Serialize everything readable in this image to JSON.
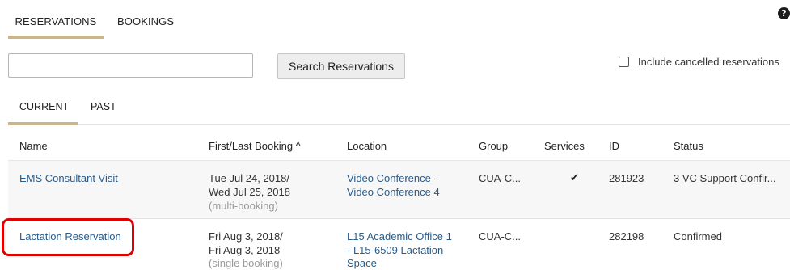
{
  "top_tabs": [
    {
      "label": "RESERVATIONS",
      "active": true
    },
    {
      "label": "BOOKINGS",
      "active": false
    }
  ],
  "help_icon": "question-circle-icon",
  "search": {
    "value": "",
    "placeholder": "",
    "button_label": "Search Reservations"
  },
  "include_cancelled": {
    "label": "Include cancelled reservations",
    "checked": false
  },
  "sub_tabs": [
    {
      "label": "CURRENT",
      "active": true
    },
    {
      "label": "PAST",
      "active": false
    }
  ],
  "table": {
    "columns": [
      "Name",
      "First/Last Booking ^",
      "Location",
      "Group",
      "Services",
      "ID",
      "Status"
    ],
    "rows": [
      {
        "name": "EMS Consultant Visit",
        "booking_first": "Tue Jul 24, 2018/",
        "booking_last": "Wed Jul 25, 2018",
        "booking_note": "(multi-booking)",
        "location_line1": "Video Conference -",
        "location_line2": "Video Conference 4",
        "location_line3": "",
        "group": "CUA-C...",
        "services": "✔",
        "id": "281923",
        "status": "3 VC Support Confir..."
      },
      {
        "name": "Lactation Reservation",
        "booking_first": "Fri Aug 3, 2018/",
        "booking_last": "Fri Aug 3, 2018",
        "booking_note": "(single booking)",
        "location_line1": "L15 Academic Office 1",
        "location_line2": "- L15-6509 Lactation",
        "location_line3": "Space",
        "group": "CUA-C...",
        "services": "",
        "id": "282198",
        "status": "Confirmed"
      }
    ]
  },
  "colors": {
    "accent_underline": "#c9b68c",
    "link": "#2a5c8a",
    "highlight_box": "#e00000",
    "row_alt": "#f7f7f7"
  }
}
